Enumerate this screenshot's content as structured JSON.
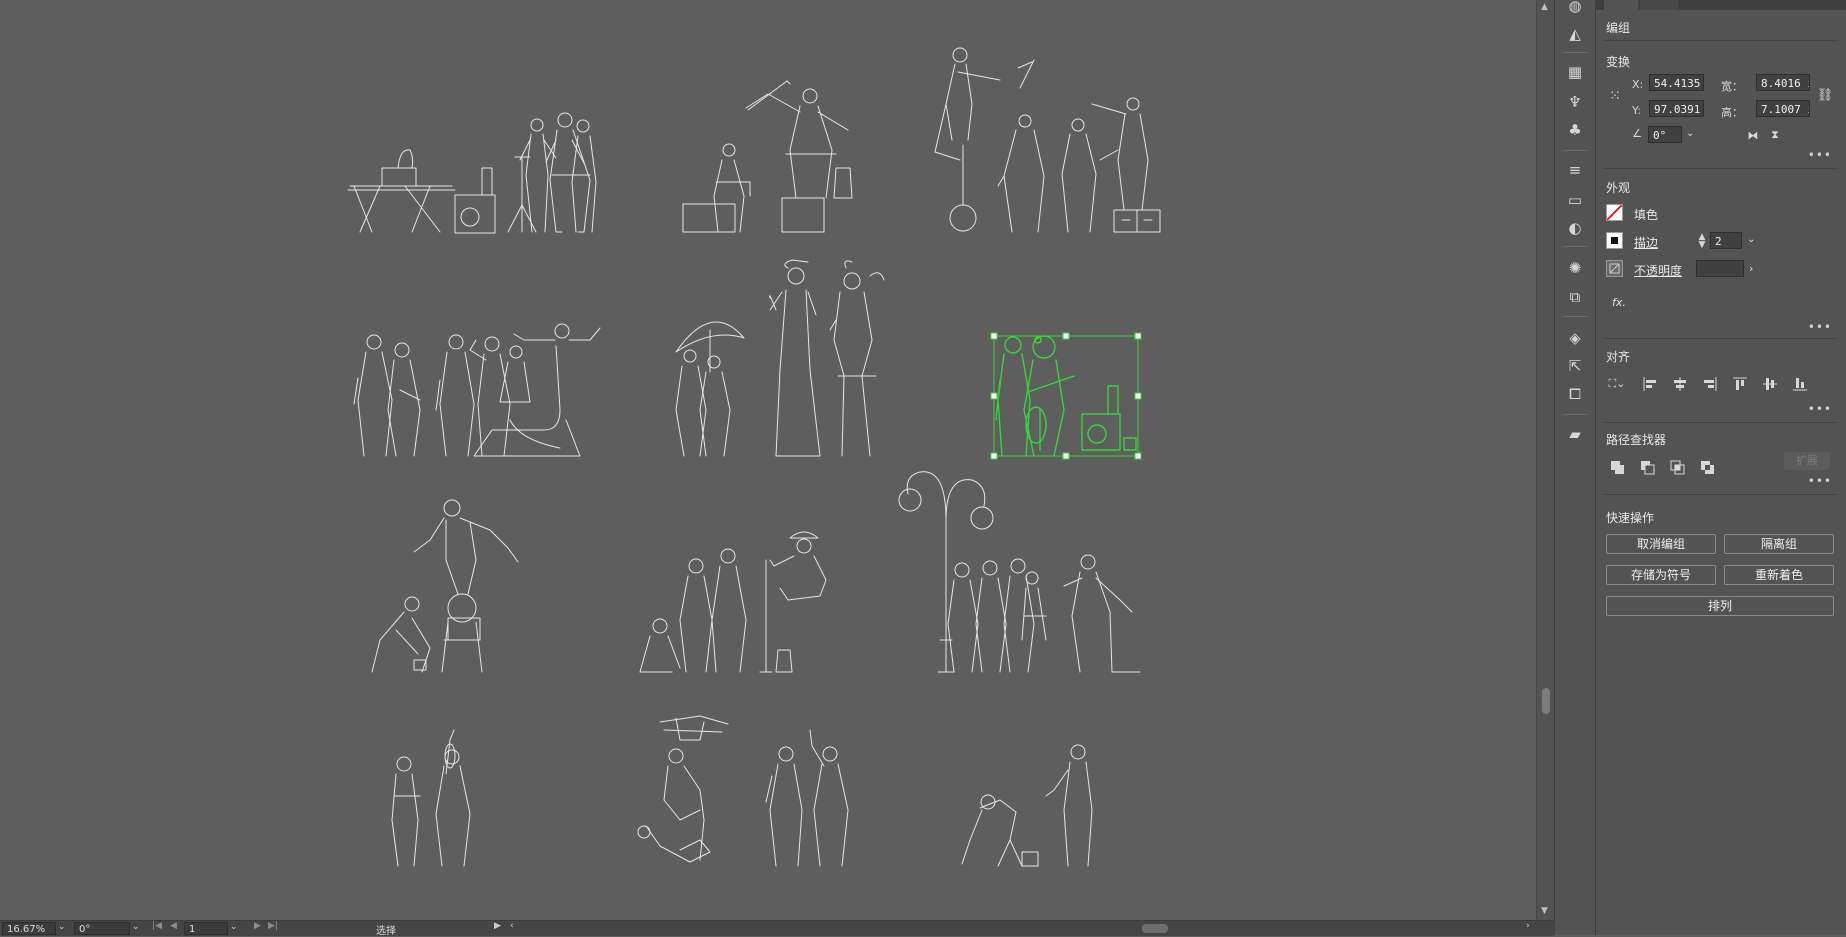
{
  "status_bar": {
    "zoom": "16.67%",
    "rotation": "0°",
    "artboard": "1",
    "tool": "选择"
  },
  "panel": {
    "section_group": "编组",
    "transform": {
      "title": "变换",
      "x_label": "X:",
      "x_value": "54.4135",
      "y_label": "Y:",
      "y_value": "97.0391",
      "w_label": "宽：",
      "w_value": "8.4016 i",
      "h_label": "高：",
      "h_value": "7.1007 i",
      "angle": "0°"
    },
    "appearance": {
      "title": "外观",
      "fill_label": "填色",
      "stroke_label": "描边",
      "stroke_weight": "2",
      "opacity_label": "不透明度",
      "fx_label": "fx."
    },
    "align": {
      "title": "对齐"
    },
    "pathfinder": {
      "title": "路径查找器",
      "expand_label": "扩展"
    },
    "quick_actions": {
      "title": "快速操作",
      "ungroup": "取消编组",
      "isolate": "隔离组",
      "save_symbol": "存储为符号",
      "recolor": "重新着色",
      "arrange": "排列"
    }
  },
  "colors": {
    "canvas": "#5e5e5e",
    "panel": "#535353",
    "selection": "#39d43a",
    "artwork_line": "#e8e8e8"
  }
}
